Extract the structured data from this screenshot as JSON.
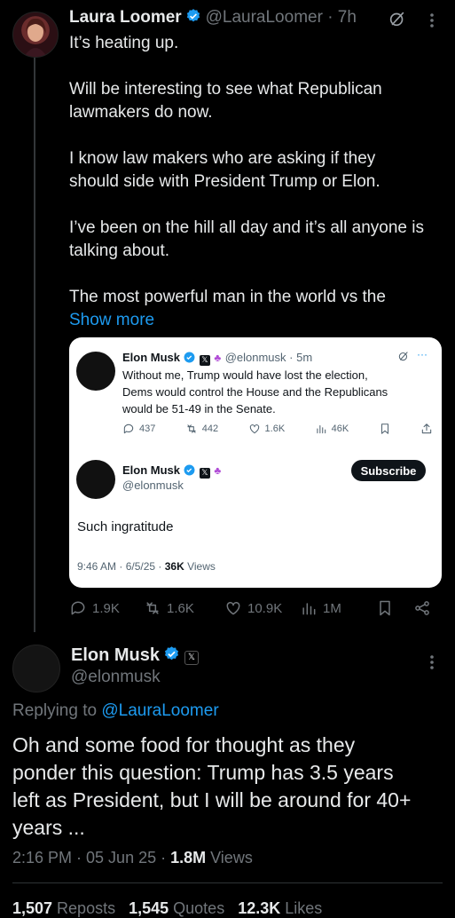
{
  "tweet1": {
    "author_name": "Laura Loomer",
    "handle_time": "@LauraLoomer · 7h",
    "paragraphs": [
      "It’s heating up.",
      "Will be interesting to see what Republican lawmakers do now.",
      "I know law makers who are asking if they should side with President Trump or Elon.",
      "I’ve been on the hill all day and it’s all anyone is talking about.",
      "The most powerful man in the world vs the"
    ],
    "show_more": "Show more",
    "actions": {
      "replies": "1.9K",
      "reposts": "1.6K",
      "likes": "10.9K",
      "views": "1M"
    }
  },
  "quote": {
    "author_name": "Elon Musk",
    "handle_time": "@elonmusk · 5m",
    "text_lines": [
      "Without me, Trump would have lost the election,",
      "Dems would control the House and the Republicans",
      "would be 51-49 in the Senate."
    ],
    "metrics": {
      "replies": "437",
      "reposts": "442",
      "likes": "1.6K",
      "views": "46K"
    },
    "reply_author_name": "Elon Musk",
    "reply_handle": "@elonmusk",
    "subscribe_label": "Subscribe",
    "reply_text": "Such ingratitude",
    "timestamp": "9:46 AM · 6/5/25 · ",
    "views_count": "36K",
    "views_label": " Views"
  },
  "tweet2": {
    "author_name": "Elon Musk",
    "handle": "@elonmusk",
    "replying_prefix": "Replying to ",
    "replying_handle": "@LauraLoomer",
    "text_lines": [
      "Oh and some food for thought as they",
      "ponder this question: Trump has 3.5 years",
      "left as President, but I will be around for 40+",
      "years ..."
    ],
    "timestamp": "2:16 PM · 05 Jun 25 · ",
    "views_count": "1.8M",
    "views_label": " Views",
    "stats": {
      "reposts_count": "1,507",
      "reposts_label": " Reposts",
      "quotes_count": "1,545",
      "quotes_label": " Quotes",
      "likes_count": "12.3K",
      "likes_label": " Likes"
    }
  },
  "colors": {
    "accent": "#1d9bf0",
    "background": "#000000",
    "card": "#ffffff",
    "muted": "#71767b"
  },
  "icons": [
    "verified-icon",
    "grok-icon",
    "more-icon",
    "reply-icon",
    "repost-icon",
    "like-icon",
    "views-icon",
    "bookmark-icon",
    "share-icon",
    "x-badge-icon",
    "affiliate-icon"
  ]
}
